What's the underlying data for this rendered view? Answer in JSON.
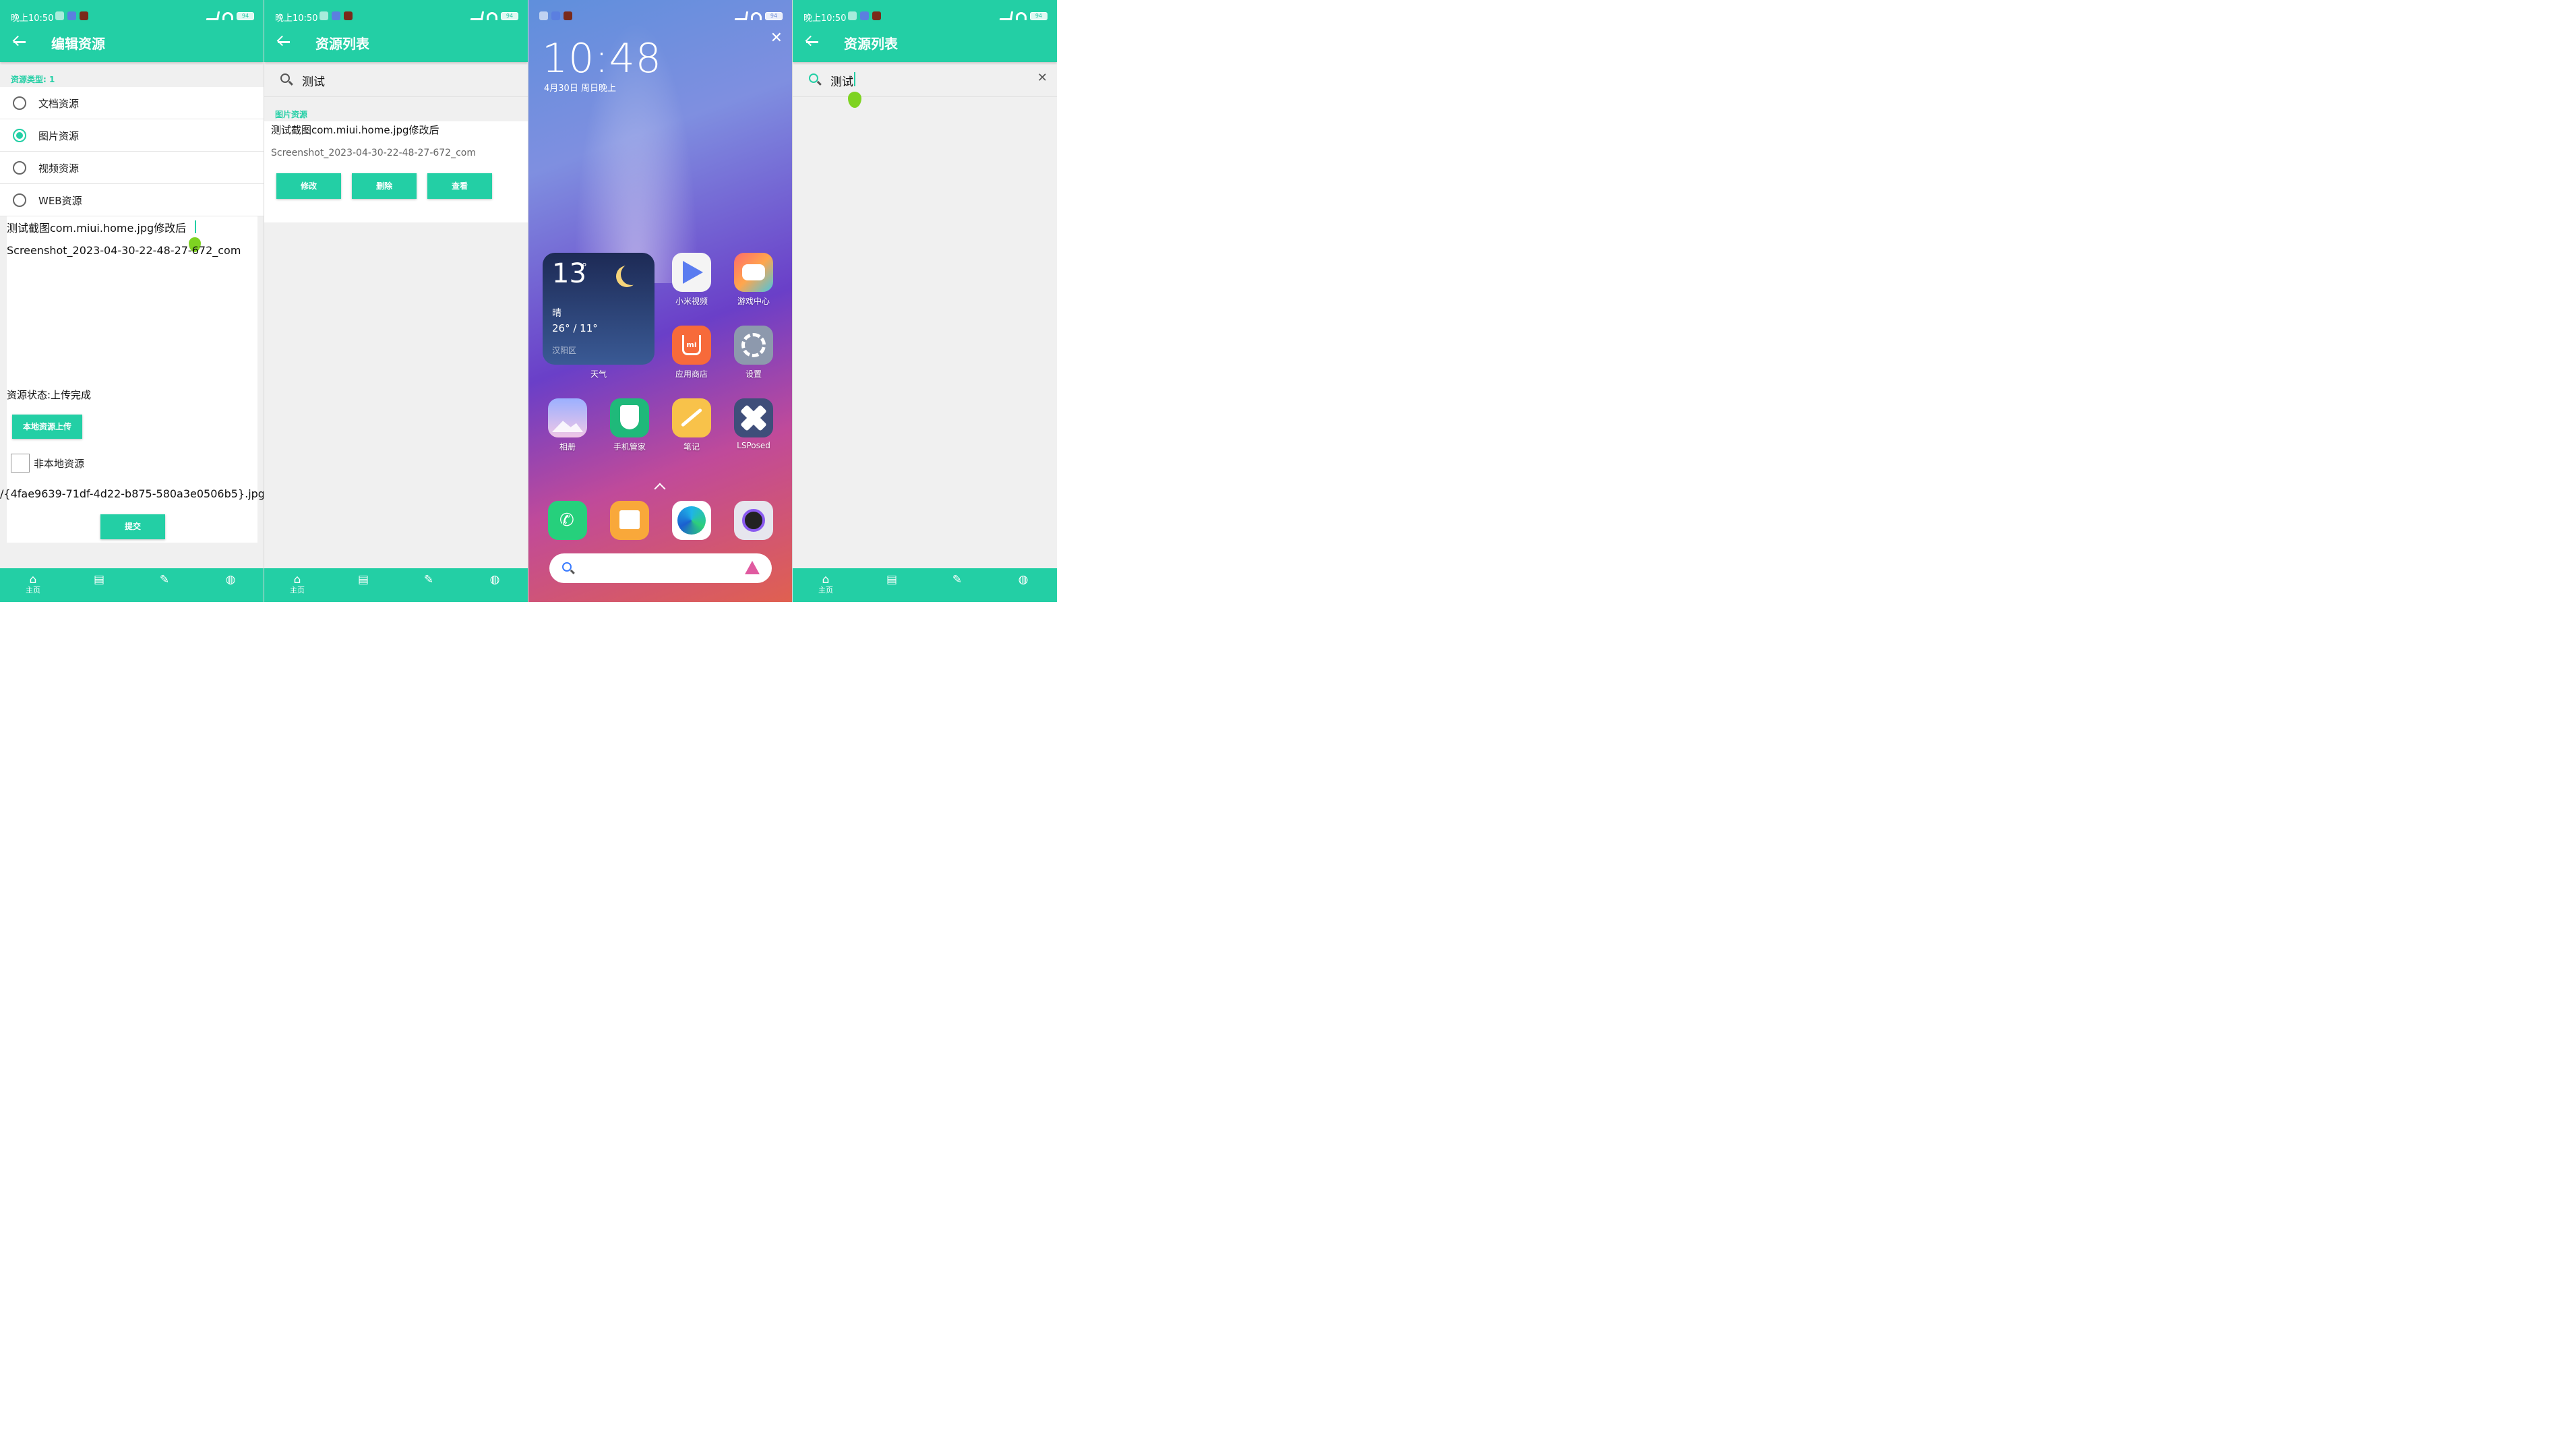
{
  "status": {
    "time": "晚上10:50",
    "battery": "94"
  },
  "nav": {
    "items": [
      {
        "label": "主页"
      },
      {
        "label": ""
      },
      {
        "label": ""
      },
      {
        "label": ""
      }
    ]
  },
  "edit": {
    "title": "编辑资源",
    "type_label": "资源类型: 1",
    "options": [
      {
        "label": "文档资源"
      },
      {
        "label": "图片资源"
      },
      {
        "label": "视频资源"
      },
      {
        "label": "WEB资源"
      }
    ],
    "name_value": "测试截图com.miui.home.jpg修改后",
    "desc_value": "Screenshot_2023-04-30-22-48-27-672_com",
    "status_text": "资源状态:上传完成",
    "upload_button": "本地资源上传",
    "non_local_label": "非本地资源",
    "path_value": "/{4fae9639-71df-4d22-b875-580a3e0506b5}.jpg",
    "submit_button": "提交"
  },
  "list": {
    "title": "资源列表",
    "search_value": "测试",
    "section_label": "图片资源",
    "item_title": "测试截图com.miui.home.jpg修改后",
    "item_subtitle": "Screenshot_2023-04-30-22-48-27-672_com",
    "buttons": {
      "edit": "修改",
      "delete": "删除",
      "view": "查看"
    }
  },
  "home": {
    "clock": "10:48",
    "date": "4月30日 周日晚上",
    "weather": {
      "temp": "13",
      "degree": "°",
      "condition": "晴",
      "range": "26° / 11°",
      "location": "汉阳区",
      "label": "天气"
    },
    "apps": [
      {
        "label": "小米视频"
      },
      {
        "label": "游戏中心"
      },
      {
        "label": "应用商店"
      },
      {
        "label": "设置"
      },
      {
        "label": "相册"
      },
      {
        "label": "手机管家"
      },
      {
        "label": "笔记"
      },
      {
        "label": "LSPosed"
      }
    ]
  },
  "search": {
    "title": "资源列表",
    "search_value": "测试"
  },
  "colors": {
    "accent": "#23cfa5",
    "background": "#f0f0f0"
  }
}
